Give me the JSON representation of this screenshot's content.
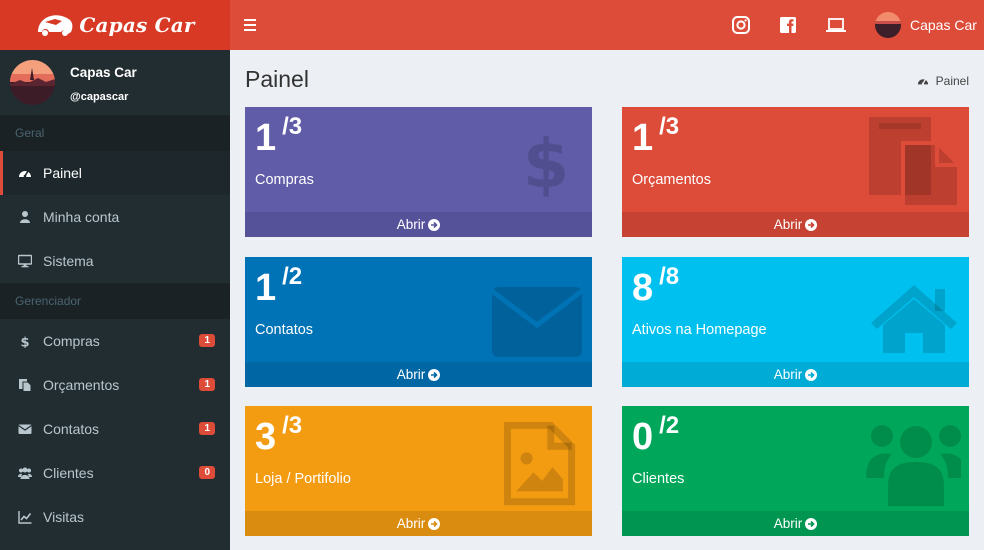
{
  "brand": {
    "name": "Capas Car"
  },
  "topbar": {
    "user_name": "Capas Car"
  },
  "user_panel": {
    "name": "Capas Car",
    "handle": "@capascar"
  },
  "sidebar": {
    "section_geral": "Geral",
    "section_gerenciador": "Gerenciador",
    "geral_items": [
      {
        "label": "Painel",
        "icon": "dashboard-icon"
      },
      {
        "label": "Minha conta",
        "icon": "user-icon"
      },
      {
        "label": "Sistema",
        "icon": "desktop-icon"
      }
    ],
    "gerenciador_items": [
      {
        "label": "Compras",
        "icon": "dollar-icon",
        "badge": "1"
      },
      {
        "label": "Orçamentos",
        "icon": "copy-icon",
        "badge": "1"
      },
      {
        "label": "Contatos",
        "icon": "envelope-icon",
        "badge": "1"
      },
      {
        "label": "Clientes",
        "icon": "users-icon",
        "badge": "0"
      },
      {
        "label": "Visitas",
        "icon": "line-chart-icon"
      }
    ]
  },
  "page": {
    "title": "Painel",
    "breadcrumb": "Painel"
  },
  "boxes": [
    {
      "count": "1",
      "total": "/3",
      "label": "Compras",
      "link": "Abrir",
      "color": "#605ca8",
      "footer_color": "#56529a",
      "icon": "dollar-icon"
    },
    {
      "count": "1",
      "total": "/3",
      "label": "Orçamentos",
      "link": "Abrir",
      "color": "#dd4b39",
      "footer_color": "#c64333",
      "icon": "copy-icon"
    },
    {
      "count": "1",
      "total": "/2",
      "label": "Contatos",
      "link": "Abrir",
      "color": "#0073b7",
      "footer_color": "#0067a4",
      "icon": "envelope-icon"
    },
    {
      "count": "8",
      "total": "/8",
      "label": "Ativos na Homepage",
      "link": "Abrir",
      "color": "#00c0ef",
      "footer_color": "#00acd6",
      "icon": "home-icon"
    },
    {
      "count": "3",
      "total": "/3",
      "label": "Loja / Portifolio",
      "link": "Abrir",
      "color": "#f39c12",
      "footer_color": "#da8c10",
      "icon": "image-file-icon"
    },
    {
      "count": "0",
      "total": "/2",
      "label": "Clientes",
      "link": "Abrir",
      "color": "#00a65a",
      "footer_color": "#009551",
      "icon": "users-icon"
    }
  ]
}
